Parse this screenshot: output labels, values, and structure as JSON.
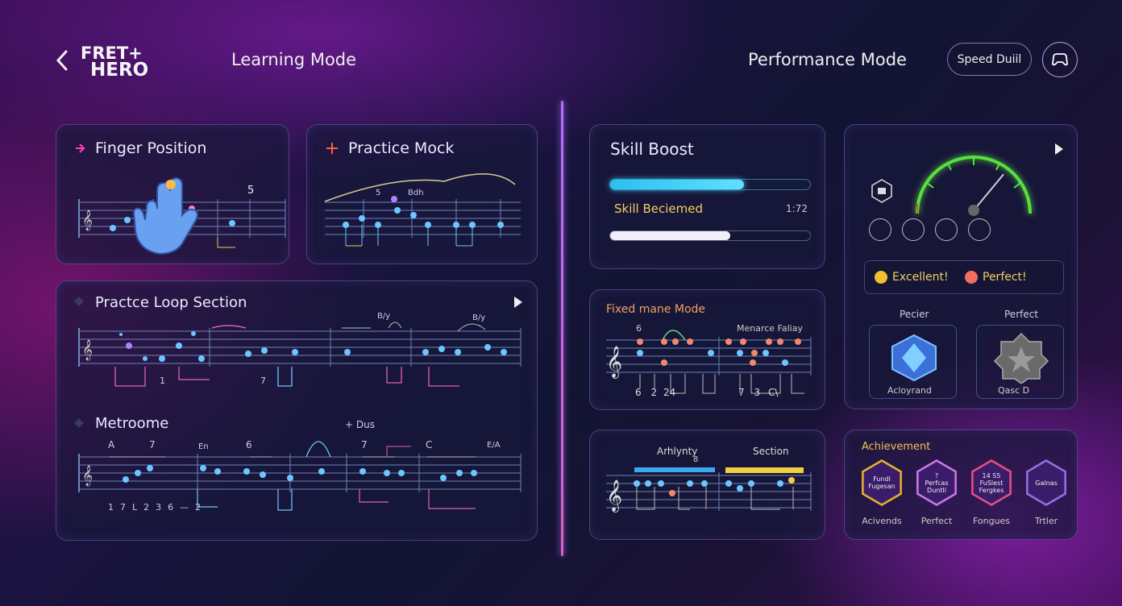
{
  "header": {
    "logo_line1": "FRET+",
    "logo_line2": "HERO",
    "learning_mode": "Learning Mode",
    "performance_mode": "Performance Mode",
    "speed_drill": "Speed Duiil"
  },
  "learning": {
    "finger_position": {
      "title": "Finger Position",
      "fret_number": "5"
    },
    "practice_mock": {
      "title": "Practice Mock",
      "annotations": [
        "5",
        "Bdh"
      ]
    },
    "practice_loop": {
      "title": "Practce Loop Section",
      "annotations": [
        "B/y",
        "B/y"
      ],
      "tab_numbers": [
        "1",
        "7"
      ]
    },
    "metronome": {
      "title": "Metroome",
      "extra": "+ Dus",
      "annotations": [
        "A",
        "7",
        "En",
        "6",
        "7",
        "C",
        "E/A"
      ],
      "tab_numbers": [
        "1",
        "7",
        "L",
        "2",
        "3",
        "6",
        "—",
        "2"
      ]
    }
  },
  "performance": {
    "skill_boost": {
      "title": "Skill Boost",
      "status": "Skill Beciemed",
      "time": "1:72",
      "progress_main": 0.67,
      "progress_secondary": 0.6
    },
    "fixed_mode": {
      "title": "Fixed mane Mode",
      "subtitle": "Menarce Faliay",
      "top_label": "6",
      "tab_numbers": [
        "6",
        "2",
        "24",
        "7",
        "3",
        "C\\"
      ]
    },
    "activity": {
      "label1": "Arhlynty",
      "label2": "Section",
      "sub_label": "8"
    },
    "gauge": {
      "value": 0.72,
      "ratings": [
        "Excellent!",
        "Perfect!"
      ],
      "badge_labels_top": [
        "Pecier",
        "Perfect"
      ],
      "badge_labels_bottom": [
        "Acloyrand",
        "Qasc D"
      ]
    },
    "achievement": {
      "title": "Achievement",
      "badges": [
        {
          "text": "Fundl\nFugesan",
          "label": "Acivends",
          "color": "#e0b030"
        },
        {
          "text": "?\nPerfcas\nDuntll",
          "label": "Perfect",
          "color": "#c878e0"
        },
        {
          "text": "14 S5\nFuSlest\nFergkes",
          "label": "Fongues",
          "color": "#e05080"
        },
        {
          "text": "Galnas",
          "label": "Trtler",
          "color": "#9070e0"
        }
      ]
    }
  },
  "colors": {
    "accent_cyan": "#44d0f0",
    "accent_purple": "#b070ff",
    "accent_pink": "#e040a0",
    "gauge_green": "#58e040"
  }
}
